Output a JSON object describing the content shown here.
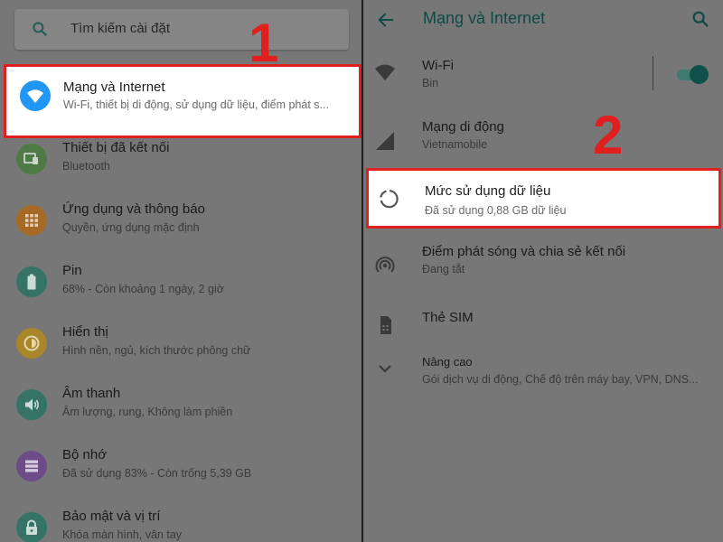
{
  "left": {
    "search_placeholder": "Tìm kiếm cài đặt",
    "highlighted": {
      "title": "Mạng và Internet",
      "subtitle": "Wi-Fi, thiết bị di động, sử dụng dữ liệu, điểm phát s...",
      "icon": "wifi-icon",
      "icon_color": "#2196f3"
    },
    "items": [
      {
        "title": "Thiết bị đã kết nối",
        "subtitle": "Bluetooth",
        "icon": "connected-devices-icon",
        "color": "#4f7a45"
      },
      {
        "title": "Ứng dụng và thông báo",
        "subtitle": "Quyền, ứng dụng mặc định",
        "icon": "apps-icon",
        "color": "#a66a25"
      },
      {
        "title": "Pin",
        "subtitle": "68% - Còn khoảng 1 ngày, 2 giờ",
        "icon": "battery-icon",
        "color": "#357365"
      },
      {
        "title": "Hiển thị",
        "subtitle": "Hình nền, ngủ, kích thước phông chữ",
        "icon": "display-icon",
        "color": "#a8862a"
      },
      {
        "title": "Âm thanh",
        "subtitle": "Âm lượng, rung, Không làm phiền",
        "icon": "sound-icon",
        "color": "#357365"
      },
      {
        "title": "Bộ nhớ",
        "subtitle": "Đã sử dụng 83% - Còn trống 5,39 GB",
        "icon": "storage-icon",
        "color": "#6c4b86"
      },
      {
        "title": "Bảo mật và vị trí",
        "subtitle": "Khóa màn hình, vân tay",
        "icon": "lock-icon",
        "color": "#357365"
      }
    ],
    "step_label": "1"
  },
  "right": {
    "title": "Mạng và Internet",
    "wifi": {
      "title": "Wi-Fi",
      "subtitle": "Bin",
      "toggle_on": true
    },
    "mobile": {
      "title": "Mạng di động",
      "subtitle": "Vietnamobile"
    },
    "data_usage": {
      "title": "Mức sử dụng dữ liệu",
      "subtitle": "Đã sử dụng 0,88 GB dữ liệu"
    },
    "hotspot": {
      "title": "Điểm phát sóng và chia sẻ kết nối",
      "subtitle": "Đang tắt"
    },
    "sim": {
      "title": "Thẻ SIM"
    },
    "advanced": {
      "title": "Nâng cao",
      "subtitle": "Gói dịch vụ di động, Chế độ trên máy bay, VPN, DNS..."
    },
    "step_label": "2"
  },
  "colors": {
    "highlight_border": "#e01f1f",
    "accent": "#0f5148",
    "dim_background": "#777777"
  }
}
